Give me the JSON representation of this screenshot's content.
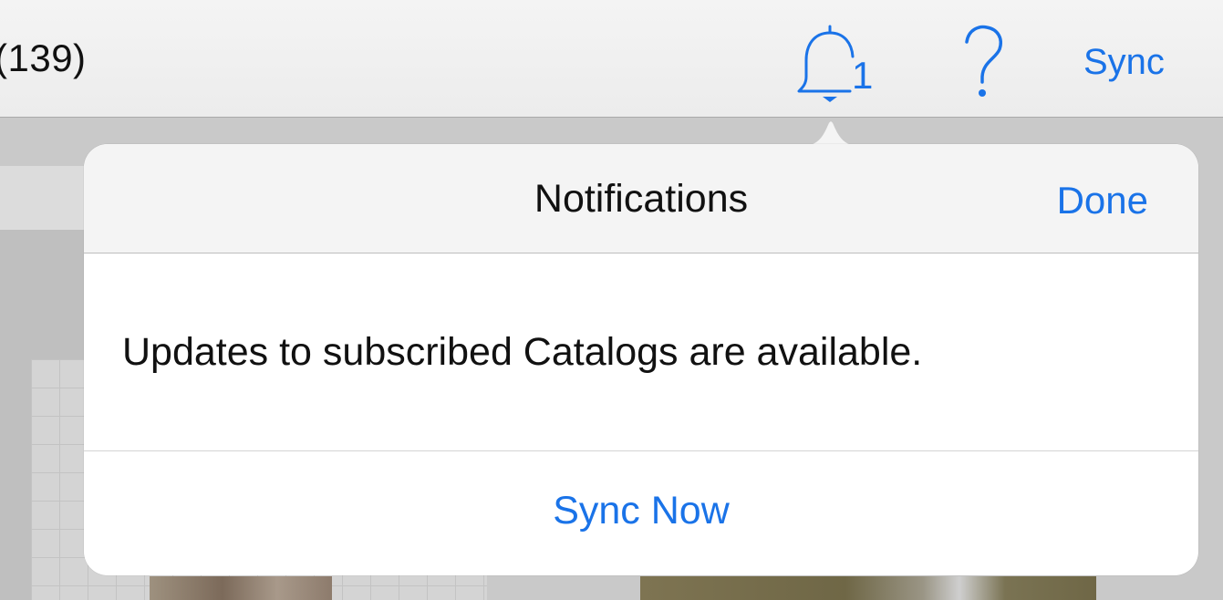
{
  "navbar": {
    "count_text": "(139)",
    "bell_badge": "1",
    "sync_label": "Sync",
    "icons": [
      "bell-icon",
      "help-icon"
    ],
    "accent_color": "#1a73e8"
  },
  "popover": {
    "title": "Notifications",
    "done_label": "Done",
    "message": "Updates to subscribed Catalogs are available.",
    "action_label": "Sync Now"
  }
}
